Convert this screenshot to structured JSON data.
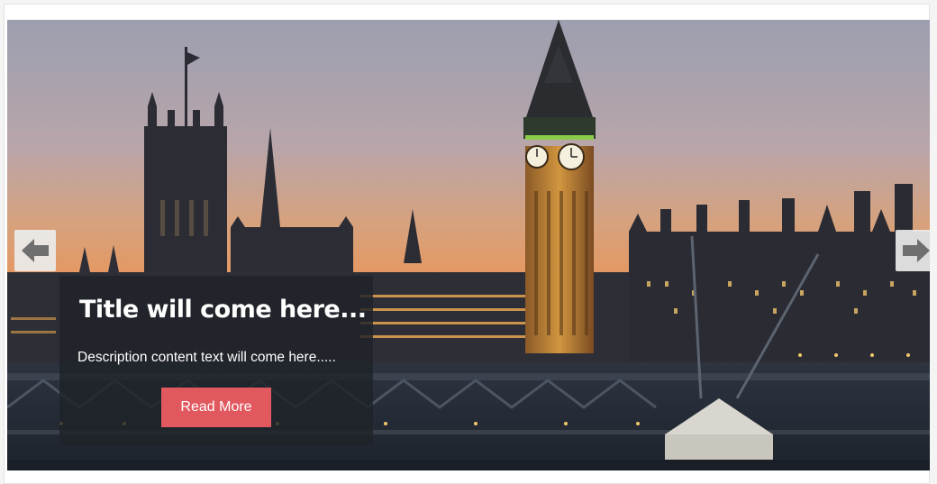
{
  "slider": {
    "slide": {
      "title": "Title will come here...",
      "description": "Description content text will come here.....",
      "button_label": "Read More",
      "image_subject": "London skyline at dusk with Houses of Parliament and Big Ben"
    },
    "prev_icon": "arrow-left-icon",
    "next_icon": "arrow-right-icon"
  },
  "colors": {
    "button_bg": "#e2585f",
    "caption_bg": "#1e2228",
    "arrow_bg": "#ebebeb",
    "arrow_glyph": "#6f6f6f"
  }
}
